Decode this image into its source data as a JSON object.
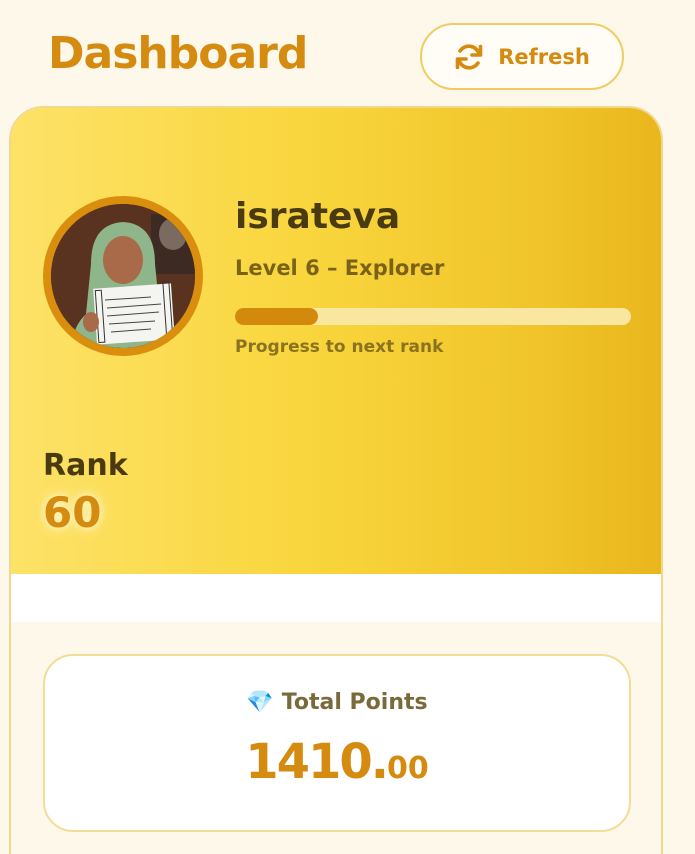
{
  "header": {
    "title": "Dashboard",
    "refresh_label": "Refresh",
    "refresh_icon": "refresh-icon"
  },
  "profile": {
    "username": "israteva",
    "level_text": "Level 6 – Explorer",
    "progress_label": "Progress to next rank",
    "progress_fraction": 0.21,
    "avatar_icon": "user-photo"
  },
  "rank": {
    "label": "Rank",
    "value": "60"
  },
  "points": {
    "icon": "gem-icon",
    "icon_glyph": "💎",
    "label": "Total Points",
    "integer": "1410.",
    "decimal": "00"
  },
  "colors": {
    "accent": "#d48b10",
    "background": "#fdf8ea",
    "hero_start": "#fde268",
    "hero_end": "#e9b71d",
    "text_dark": "#4a3a10"
  }
}
